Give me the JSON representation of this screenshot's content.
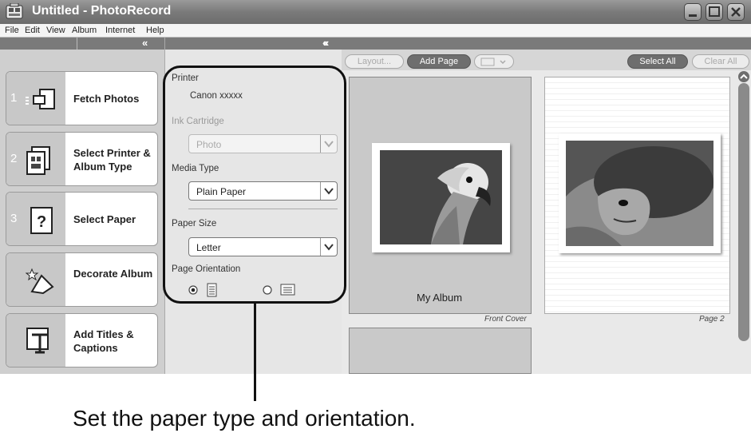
{
  "window": {
    "title": "Untitled - PhotoRecord"
  },
  "menu": {
    "items": [
      "File",
      "Edit",
      "View",
      "Album",
      "Internet",
      "Help"
    ]
  },
  "steps": [
    {
      "num": "1",
      "label": "Fetch Photos",
      "icon": "fetch-photos-icon"
    },
    {
      "num": "2",
      "label": "Select Printer & Album Type",
      "icon": "printer-album-icon"
    },
    {
      "num": "3",
      "label": "Select Paper",
      "icon": "select-paper-icon",
      "active": true
    },
    {
      "num": "",
      "label": "Decorate Album",
      "icon": "decorate-icon"
    },
    {
      "num": "",
      "label": "Add Titles & Captions",
      "icon": "titles-icon"
    }
  ],
  "settings": {
    "printer_label": "Printer",
    "printer_value": "Canon xxxxx",
    "ink_label": "Ink Cartridge",
    "ink_value": "Photo",
    "media_label": "Media Type",
    "media_value": "Plain Paper",
    "size_label": "Paper Size",
    "size_value": "Letter",
    "orientation_label": "Page Orientation",
    "orientation_selected": "portrait"
  },
  "toolbar": {
    "layout": "Layout...",
    "add_page": "Add Page",
    "select_all": "Select All",
    "clear_all": "Clear All"
  },
  "pages": {
    "cover_title": "My Album",
    "cover_caption": "Front Cover",
    "page2_caption": "Page 2"
  },
  "annotation": "Set the paper type and orientation.",
  "colors": {
    "titlebar": "#7a7a7a",
    "button_dark": "#6e6e6e",
    "highlight": "#111111"
  }
}
